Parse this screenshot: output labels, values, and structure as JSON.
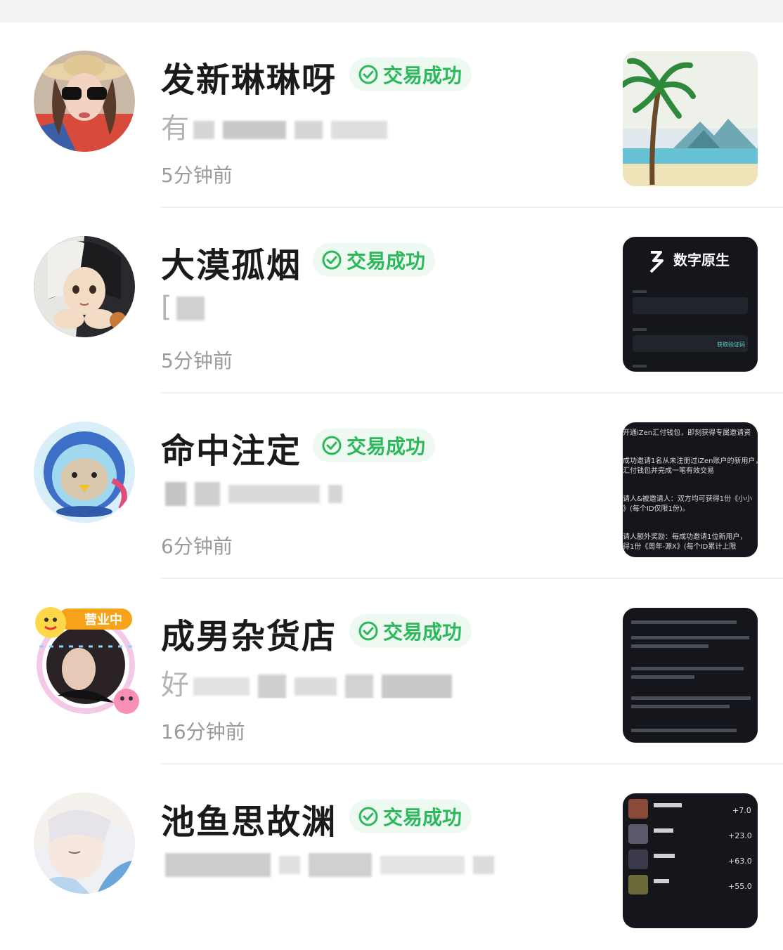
{
  "status_badge_label": "交易成功",
  "thumb_labels": {
    "digital_native": "数字原生",
    "get_code": "获取验证码",
    "invite_line1": "开通iZen汇付钱包，即刻获得专属邀请资",
    "invite_line2": "成功邀请1名从未注册过iZen账户的新用户，",
    "invite_line3": "汇付钱包并完成一笔有效交易",
    "invite_line4": "请人&被邀请人：双方均可获得1份《小小",
    "invite_line5": "》(每个ID仅限1份)。",
    "invite_line6": "请人额外奖励：每成功邀请1位新用户，",
    "invite_line7": "得1份《周年-源X》(每个ID累计上限",
    "avatar_badge": "营业中",
    "rank_values": [
      "+7.0",
      "+23.0",
      "+63.0",
      "+55.0"
    ]
  },
  "items": [
    {
      "name": "发新琳琳呀",
      "preview": "有",
      "time": "5分钟前"
    },
    {
      "name": "大漠孤烟",
      "preview": "[",
      "time": "5分钟前"
    },
    {
      "name": "命中注定",
      "preview": "",
      "time": "6分钟前"
    },
    {
      "name": "成男杂货店",
      "preview": "好",
      "time": "16分钟前"
    },
    {
      "name": "池鱼思故渊",
      "preview": "",
      "time": ""
    }
  ],
  "colors": {
    "accent_green": "#2db85b",
    "badge_bg": "#eefaf1",
    "divider": "#f0f0f0"
  },
  "icons": [
    "check-circle-icon"
  ]
}
